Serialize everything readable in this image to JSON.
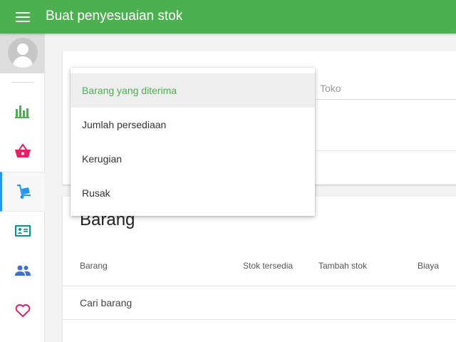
{
  "app": {
    "title": "Buat penyesuaian stok"
  },
  "icons": {
    "menu": "hamburger-icon",
    "avatar": "user-avatar-icon",
    "nav": [
      "bar-chart-icon",
      "shopping-basket-icon",
      "hand-truck-icon",
      "id-card-icon",
      "people-icon",
      "heart-icon"
    ]
  },
  "colors": {
    "primary": "#4caf50",
    "active_indicator": "#2196f3",
    "nav_chart": "#4caf50",
    "nav_basket": "#e91e63",
    "nav_truck": "#2196f3",
    "nav_card": "#009688",
    "nav_people": "#3f6fd1",
    "nav_heart": "#e91e63"
  },
  "form": {
    "store_label": "Toko"
  },
  "reason_dropdown": {
    "options": [
      "Barang yang diterima",
      "Jumlah persediaan",
      "Kerugian",
      "Rusak"
    ],
    "selected": "Barang yang diterima"
  },
  "items_section": {
    "title": "Barang",
    "columns": [
      "Barang",
      "Stok tersedia",
      "Tambah stok",
      "Biaya"
    ],
    "search_placeholder": "Cari barang"
  }
}
